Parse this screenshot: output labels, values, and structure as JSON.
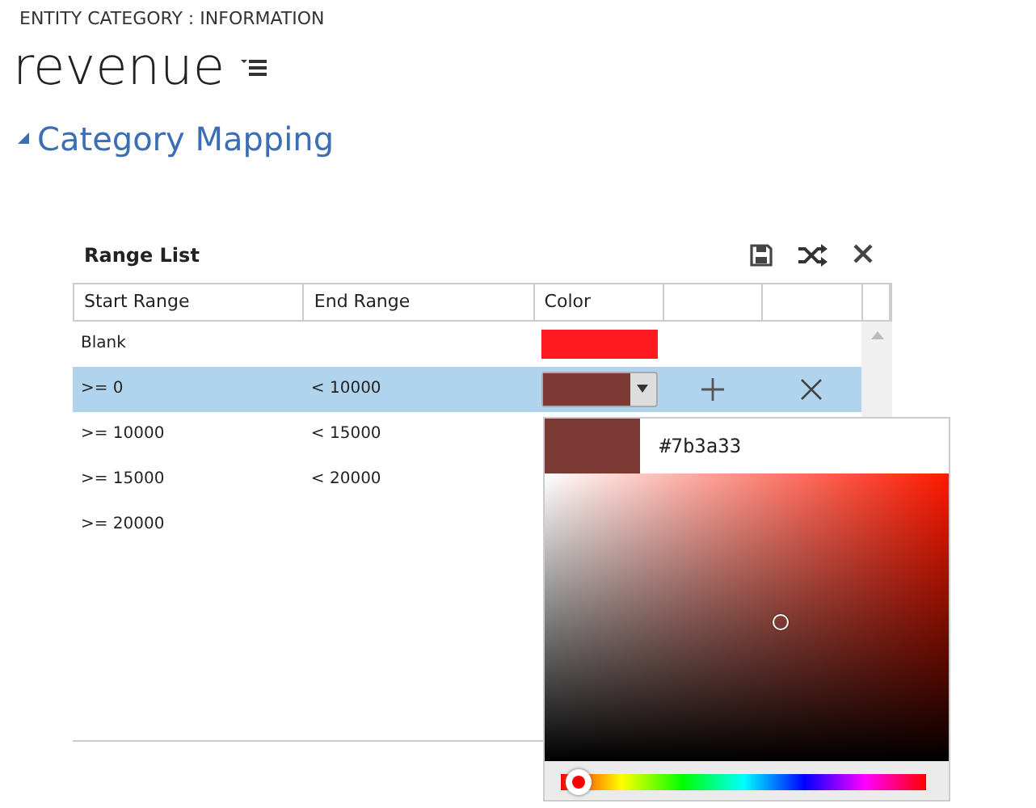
{
  "breadcrumb": "ENTITY CATEGORY : INFORMATION",
  "title": "revenue",
  "section": {
    "title": "Category Mapping",
    "expanded": true
  },
  "grid": {
    "title": "Range List",
    "columns": [
      "Start Range",
      "End Range",
      "Color"
    ],
    "rows": [
      {
        "start": "Blank",
        "color": "#ff1a22",
        "selected": false
      },
      {
        "start": ">= 0",
        "end": "< 10000",
        "color": "#7b3a33",
        "selected": true
      },
      {
        "start": ">= 10000",
        "end": "< 15000",
        "selected": false
      },
      {
        "start": ">= 15000",
        "end": "< 20000",
        "selected": false
      },
      {
        "start": ">= 20000",
        "selected": false
      }
    ]
  },
  "picker": {
    "value": "#7b3a33"
  }
}
